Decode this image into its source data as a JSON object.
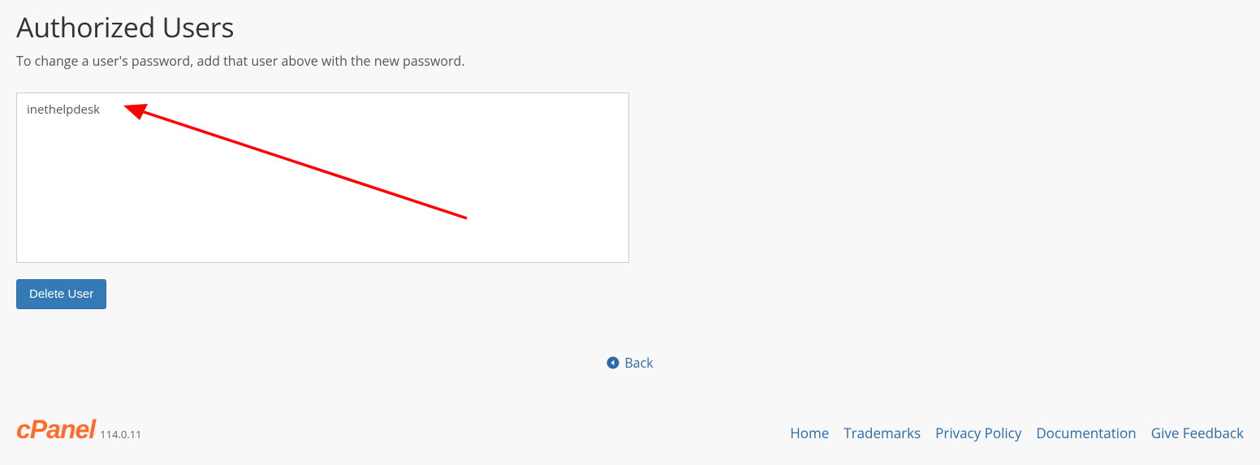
{
  "title": "Authorized Users",
  "subtitle": "To change a user's password, add that user above with the new password.",
  "users": [
    "inethelpdesk"
  ],
  "delete_button_label": "Delete User",
  "back_label": "Back",
  "logo_text": "cPanel",
  "version": "114.0.11",
  "footer_links": {
    "home": "Home",
    "trademarks": "Trademarks",
    "privacy": "Privacy Policy",
    "docs": "Documentation",
    "feedback": "Give Feedback"
  }
}
